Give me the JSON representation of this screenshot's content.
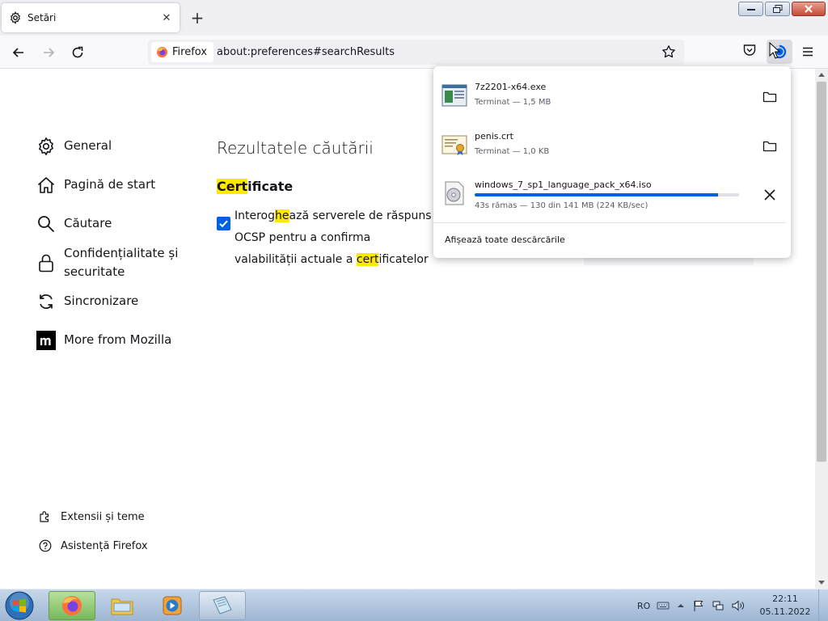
{
  "tab": {
    "title": "Setări",
    "close_glyph": "✕",
    "icon": "gear-icon"
  },
  "newtab_glyph": "+",
  "identity": {
    "label": "Firefox",
    "icon": "firefox-logo-icon"
  },
  "url": "about:preferences#searchResults",
  "sidebar": {
    "items": [
      {
        "label": "General",
        "icon": "gear-icon"
      },
      {
        "label": "Pagină de start",
        "icon": "home-icon"
      },
      {
        "label": "Căutare",
        "icon": "search-icon"
      },
      {
        "label": "Confidențialitate și securitate",
        "icon": "lock-icon"
      },
      {
        "label": "Sincronizare",
        "icon": "sync-icon"
      },
      {
        "label": "More from Mozilla",
        "icon": "mozilla-m-icon"
      }
    ],
    "footer": [
      {
        "label": "Extensii și teme",
        "icon": "puzzle-icon"
      },
      {
        "label": "Asistență Firefox",
        "icon": "help-icon"
      }
    ]
  },
  "main": {
    "title": "Rezultatele căutării",
    "cert_heading": {
      "highlight": "Cert",
      "rest": "ificate"
    },
    "ocsp": {
      "checked": true,
      "part1": "Interog",
      "hl1": "he",
      "part2": "ază serverele de răspuns OCSP pentru a confirma",
      "part3": "valabilității actuale a ",
      "hl2": "cert",
      "part4": "ificatelor"
    }
  },
  "downloads": {
    "items": [
      {
        "name": "7z2201-x64.exe",
        "status": "Terminat — 1,5 MB",
        "action": "folder-icon",
        "icon": "exe-file-icon"
      },
      {
        "name": "penis.crt",
        "status": "Terminat — 1,0 KB",
        "action": "folder-icon",
        "icon": "certificate-file-icon"
      },
      {
        "name": "windows_7_sp1_language_pack_x64.iso",
        "status": "43s rămas — 130 din 141 MB (224 KB/sec)",
        "action": "cancel-icon",
        "icon": "disc-image-icon",
        "progress": 0.922
      }
    ],
    "show_all": "Afișează toate descărcările"
  },
  "taskbar": {
    "apps": [
      "firefox-icon",
      "explorer-folder-icon",
      "media-player-icon",
      "notepad-icon"
    ],
    "lang": "RO",
    "time": "22:11",
    "date": "05.11.2022"
  },
  "colors": {
    "accent": "#0061e0",
    "highlight": "#ffe900",
    "tab_bg": "#f0f0f4"
  }
}
